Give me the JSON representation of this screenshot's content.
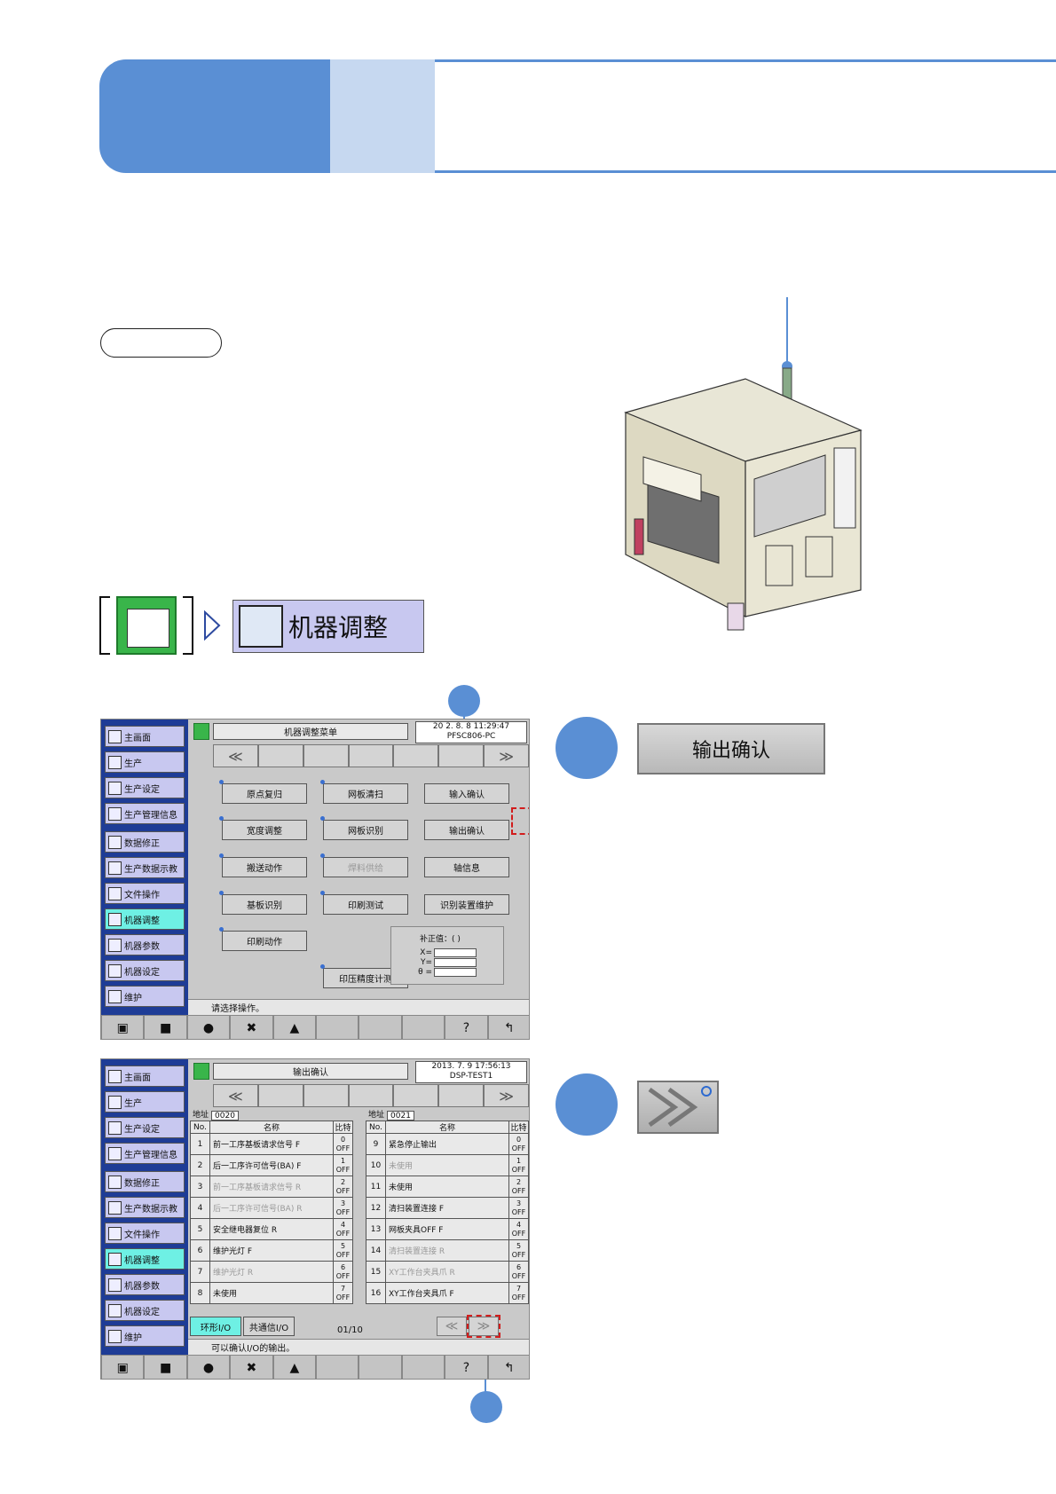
{
  "nav_path": {
    "button_label": "机器调整"
  },
  "menu_screen": {
    "title": "机器调整菜单",
    "datetime": "20  2. 8. 8 11:29:47",
    "host": "PFSC806-PC",
    "buttons": [
      {
        "label": "原点复归",
        "dim": false
      },
      {
        "label": "网板清扫",
        "dim": false
      },
      {
        "label": "输入确认",
        "dim": false
      },
      {
        "label": "宽度调整",
        "dim": false
      },
      {
        "label": "网板识别",
        "dim": false
      },
      {
        "label": "输出确认",
        "dim": false
      },
      {
        "label": "搬送动作",
        "dim": false
      },
      {
        "label": "焊料供给",
        "dim": true
      },
      {
        "label": "轴信息",
        "dim": false
      },
      {
        "label": "基板识别",
        "dim": false
      },
      {
        "label": "印刷测试",
        "dim": false
      },
      {
        "label": "识别装置维护",
        "dim": false
      },
      {
        "label": "印刷动作",
        "dim": false
      },
      {
        "label": "印压精度计测",
        "dim": false
      }
    ],
    "compensation": {
      "title": "补正值：(          )",
      "x": "X=",
      "y": "Y=",
      "t": "θ ="
    },
    "status": "请选择操作。"
  },
  "output_screen": {
    "title": "输出确认",
    "datetime": "2013. 7. 9 17:56:13",
    "host": "DSP-TEST1",
    "col_no": "No.",
    "col_name": "名称",
    "col_bit": "比特",
    "addr_label": "地址",
    "left": {
      "addr": "0020",
      "rows": [
        {
          "no": "1",
          "name": "前一工序基板请求信号 F",
          "bit": "0",
          "state": "OFF",
          "dim": false
        },
        {
          "no": "2",
          "name": "后一工序许可信号(BA) F",
          "bit": "1",
          "state": "OFF",
          "dim": false
        },
        {
          "no": "3",
          "name": "前一工序基板请求信号 R",
          "bit": "2",
          "state": "OFF",
          "dim": true
        },
        {
          "no": "4",
          "name": "后一工序许可信号(BA) R",
          "bit": "3",
          "state": "OFF",
          "dim": true
        },
        {
          "no": "5",
          "name": "安全继电器复位 R",
          "bit": "4",
          "state": "OFF",
          "dim": false
        },
        {
          "no": "6",
          "name": "维护光灯 F",
          "bit": "5",
          "state": "OFF",
          "dim": false
        },
        {
          "no": "7",
          "name": "维护光灯 R",
          "bit": "6",
          "state": "OFF",
          "dim": true
        },
        {
          "no": "8",
          "name": "未使用",
          "bit": "7",
          "state": "OFF",
          "dim": false
        }
      ]
    },
    "right": {
      "addr": "0021",
      "rows": [
        {
          "no": "9",
          "name": "紧急停止输出",
          "bit": "0",
          "state": "OFF",
          "dim": false
        },
        {
          "no": "10",
          "name": "未使用",
          "bit": "1",
          "state": "OFF",
          "dim": true
        },
        {
          "no": "11",
          "name": "未使用",
          "bit": "2",
          "state": "OFF",
          "dim": false
        },
        {
          "no": "12",
          "name": "清扫装置连接 F",
          "bit": "3",
          "state": "OFF",
          "dim": false
        },
        {
          "no": "13",
          "name": "网板夹具OFF F",
          "bit": "4",
          "state": "OFF",
          "dim": false
        },
        {
          "no": "14",
          "name": "清扫装置连接 R",
          "bit": "5",
          "state": "OFF",
          "dim": true
        },
        {
          "no": "15",
          "name": "XY工作台夹具爪 R",
          "bit": "6",
          "state": "OFF",
          "dim": true
        },
        {
          "no": "16",
          "name": "XY工作台夹具爪 F",
          "bit": "7",
          "state": "OFF",
          "dim": false
        }
      ]
    },
    "tab1": "环形I/O",
    "tab2": "共通信I/O",
    "page": "01/10",
    "status": "可以确认I/O的输出。"
  },
  "sidebar": [
    "主画面",
    "生产",
    "生产设定",
    "生产管理信息",
    "数据修正",
    "生产数据示教",
    "文件操作",
    "机器调整",
    "机器参数",
    "机器设定",
    "维护"
  ],
  "callout_button_label": "输出确认",
  "colors": {
    "accent_blue": "#5a8fd4",
    "light_blue": "#c6d8f0",
    "sidebar_navy": "#1e3c96",
    "selected_cyan": "#6ef0e4",
    "highlight_red": "#d21c1c"
  }
}
